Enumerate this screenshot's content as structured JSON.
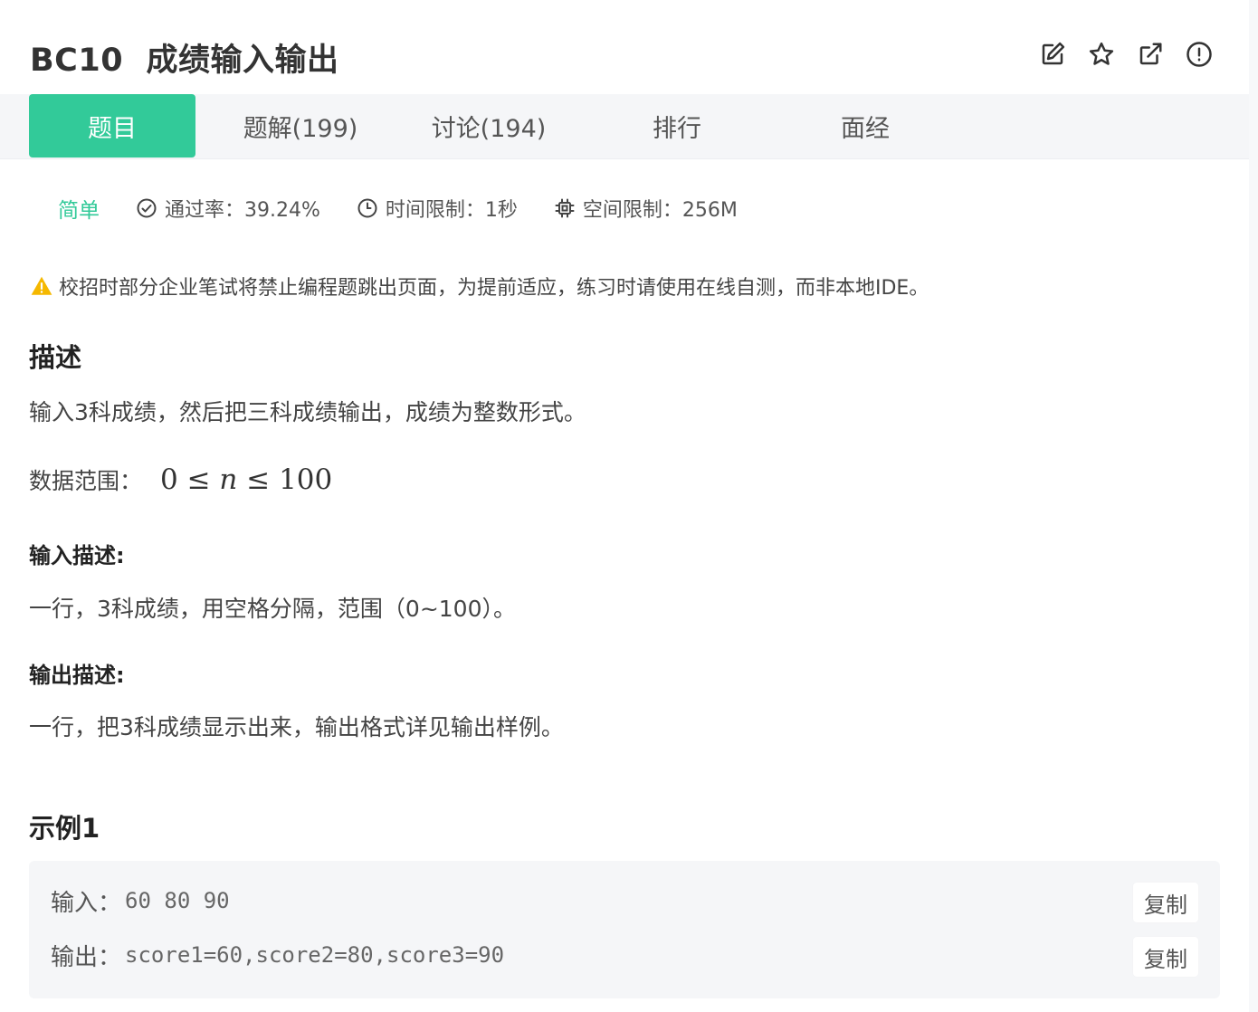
{
  "header": {
    "title": "BC10  成绩输入输出",
    "icons": [
      "edit-icon",
      "star-icon",
      "share-icon",
      "report-icon"
    ]
  },
  "tabs": [
    {
      "label": "题目",
      "active": true
    },
    {
      "label": "题解(199)",
      "active": false
    },
    {
      "label": "讨论(194)",
      "active": false
    },
    {
      "label": "排行",
      "active": false
    },
    {
      "label": "面经",
      "active": false
    }
  ],
  "meta": {
    "difficulty": "简单",
    "pass_rate": "通过率：39.24%",
    "time_limit": "时间限制：1秒",
    "space_limit": "空间限制：256M"
  },
  "notice": "校招时部分企业笔试将禁止编程题跳出页面，为提前适应，练习时请使用在线自测，而非本地IDE。",
  "description": {
    "heading": "描述",
    "text": "输入3科成绩，然后把三科成绩输出，成绩为整数形式。",
    "range_label": "数据范围：",
    "range_left": "0 ≤ ",
    "range_var": "n",
    "range_right": " ≤ 100"
  },
  "input_desc": {
    "heading": "输入描述:",
    "text": "一行，3科成绩，用空格分隔，范围（0~100）。"
  },
  "output_desc": {
    "heading": "输出描述:",
    "text": "一行，把3科成绩显示出来，输出格式详见输出样例。"
  },
  "example": {
    "heading": "示例1",
    "input_label": "输入：",
    "input_value": "60 80 90",
    "output_label": "输出：",
    "output_value": "score1=60,score2=80,score3=90",
    "copy_label": "复制"
  },
  "colors": {
    "accent": "#32ca99",
    "warning": "#f5b800"
  }
}
